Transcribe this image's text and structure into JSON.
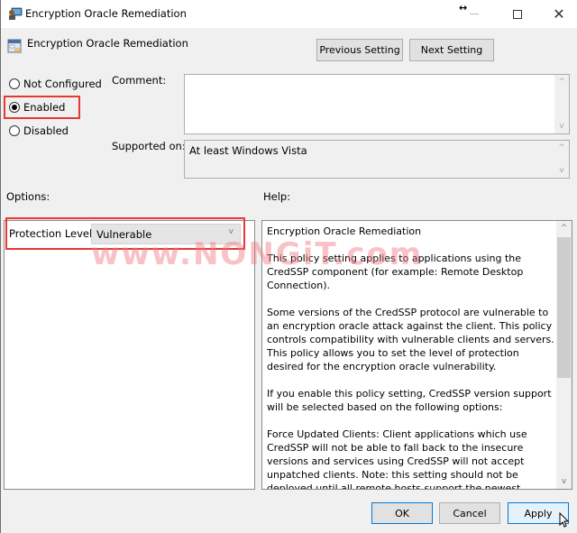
{
  "window": {
    "title": "Encryption Oracle Remediation",
    "app_icon": "group-policy-editor-icon",
    "controls": {
      "minimize": "minimize-icon",
      "maximize": "maximize-icon",
      "close": "close-icon"
    }
  },
  "header": {
    "policy_name": "Encryption Oracle Remediation",
    "policy_icon": "policy-setting-icon",
    "previous_label": "Previous Setting",
    "next_label": "Next Setting"
  },
  "state": {
    "options": [
      {
        "label": "Not Configured",
        "selected": false
      },
      {
        "label": "Enabled",
        "selected": true
      },
      {
        "label": "Disabled",
        "selected": false
      }
    ]
  },
  "comment": {
    "label": "Comment:",
    "value": ""
  },
  "supported": {
    "label": "Supported on:",
    "value": "At least Windows Vista"
  },
  "sections": {
    "options_label": "Options:",
    "help_label": "Help:"
  },
  "options_pane": {
    "protection_label": "Protection Level:",
    "protection_value": "Vulnerable"
  },
  "help": {
    "paragraphs": [
      "Encryption Oracle Remediation",
      "This policy setting applies to applications using the CredSSP component (for example: Remote Desktop Connection).",
      "Some versions of the CredSSP protocol are vulnerable to an encryption oracle attack against the client.  This policy controls compatibility with vulnerable clients and servers.  This policy allows you to set the level of protection desired for the encryption oracle vulnerability.",
      "If you enable this policy setting, CredSSP version support will be selected based on the following options:",
      "Force Updated Clients: Client applications which use CredSSP will not be able to fall back to the insecure versions and services using CredSSP will not accept unpatched clients. Note: this setting should not be deployed until all remote hosts support the newest version."
    ]
  },
  "watermark": "www.NONGiT.com",
  "footer": {
    "ok_label": "OK",
    "cancel_label": "Cancel",
    "apply_label": "Apply"
  },
  "colors": {
    "highlight": "#e53935",
    "accent": "#0078d7"
  }
}
